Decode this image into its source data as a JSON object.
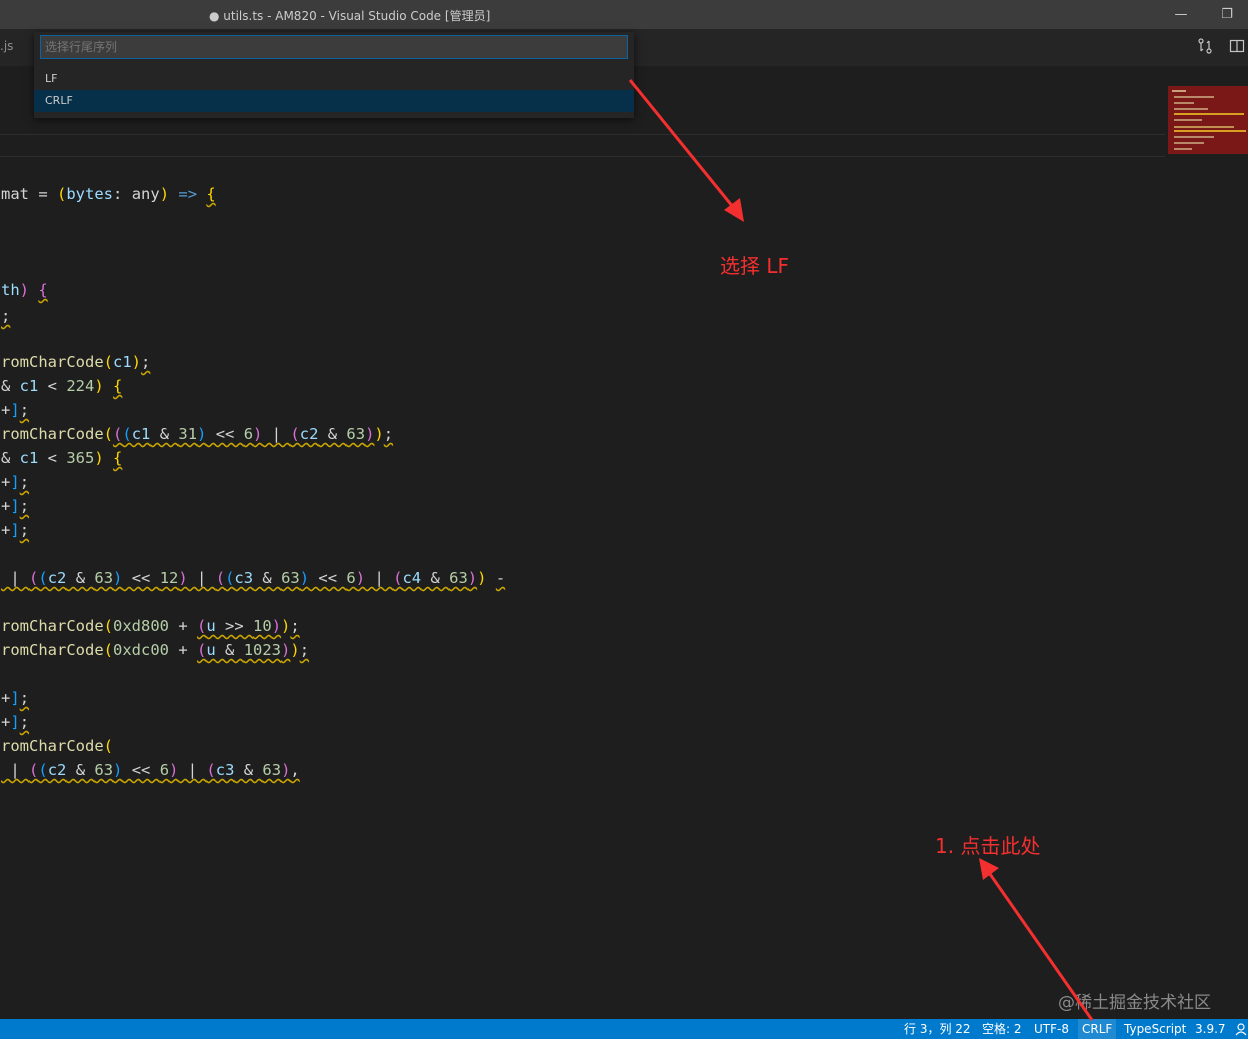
{
  "window": {
    "title": "● utils.ts - AM820 - Visual Studio Code [管理员]"
  },
  "tabs": {
    "partial_tab": ".js"
  },
  "quick_pick": {
    "placeholder": "选择行尾序列",
    "items": [
      {
        "label": "LF"
      },
      {
        "label": "CRLF",
        "selected": true
      }
    ]
  },
  "editor": {
    "lines": [
      "mat = (bytes: any) => {",
      "th) {",
      ";",
      "romCharCode(c1);",
      "& c1 < 224) {",
      "+];",
      "romCharCode(((c1 & 31) << 6) | (c2 & 63));",
      "& c1 < 365) {",
      "+];",
      "+];",
      "+];",
      " | ((c2 & 63) << 12) | ((c3 & 63) << 6) | (c4 & 63)) -",
      "romCharCode(0xd800 + (u >> 10));",
      "romCharCode(0xdc00 + (u & 1023));",
      "+];",
      "+];",
      "romCharCode(",
      " | ((c2 & 63) << 6) | (c3 & 63),"
    ]
  },
  "annotations": {
    "select_lf": "选择 LF",
    "click_here": "1. 点击此处",
    "color": "#f42f2f"
  },
  "watermark": "@稀土掘金技术社区",
  "status_bar": {
    "position": "行 3，列 22",
    "spaces": "空格: 2",
    "encoding": "UTF-8",
    "eol": "CRLF",
    "language": "TypeScript",
    "version": "3.9.7",
    "color": "#007acc"
  }
}
